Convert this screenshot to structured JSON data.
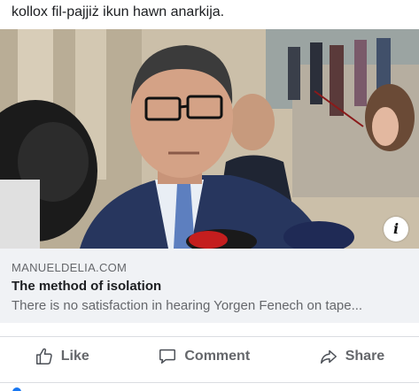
{
  "post": {
    "text": "kollox fil-pajjiż ikun hawn anarkija."
  },
  "image": {
    "info_badge": "i"
  },
  "link_preview": {
    "domain": "MANUELDELIA.COM",
    "title": "The method of isolation",
    "description": "There is no satisfaction in hearing Yorgen Fenech on tape..."
  },
  "actions": {
    "like_label": "Like",
    "comment_label": "Comment",
    "share_label": "Share"
  },
  "icons": {
    "like": "thumbs-up-icon",
    "comment": "comment-bubble-icon",
    "share": "share-arrow-icon"
  },
  "colors": {
    "action_text": "#65676b",
    "link_bg": "#f0f2f5",
    "accent": "#1877f2"
  }
}
